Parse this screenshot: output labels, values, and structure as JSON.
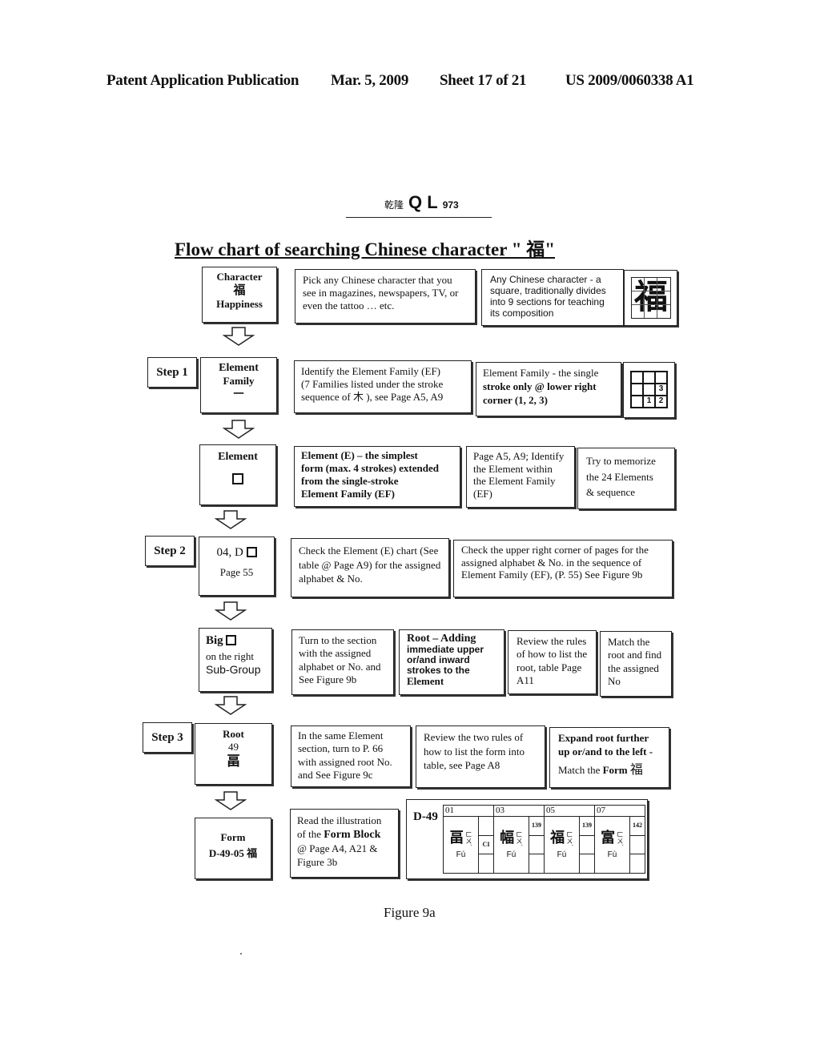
{
  "header": {
    "publication": "Patent Application Publication",
    "date": "Mar. 5, 2009",
    "sheet": "Sheet 17 of 21",
    "number": "US 2009/0060338 A1"
  },
  "logo": {
    "chinese": "乾隆",
    "letters": "Q L",
    "number": "973"
  },
  "title": "Flow chart of searching Chinese character \" 福\"",
  "rows": {
    "r0": {
      "node": {
        "line1": "Character",
        "char": "福",
        "line3": "Happiness"
      },
      "desc1": "Pick any Chinese character that you see in magazines, newspapers, TV, or even the tattoo … etc.",
      "desc2": "Any Chinese character - a square, traditionally divides into 9 sections for teaching its composition",
      "image_char": "福"
    },
    "r1": {
      "step": "Step 1",
      "node": {
        "line1": "Element",
        "line2": "Family",
        "char": "一"
      },
      "desc1_a": "Identify the Element Family (EF)",
      "desc1_b": "(7 Families listed under the stroke",
      "desc1_c": "sequence of 木 ), see Page A5, A9",
      "desc2_a": "Element Family - the single",
      "desc2_b": "stroke only @ lower right",
      "desc2_c": "corner (1, 2, 3)",
      "grid": [
        "",
        "",
        "",
        "",
        "",
        "3",
        "",
        "1",
        "2"
      ]
    },
    "r2": {
      "node": {
        "line1": "Element"
      },
      "desc1_a": "Element (E) – the simplest",
      "desc1_b": "form (max. 4 strokes) extended",
      "desc1_c": "from the single-stroke",
      "desc1_d": "Element Family (EF)",
      "desc2": "Page A5, A9; Identify the Element within the Element Family (EF)",
      "desc3_a": "Try to memorize",
      "desc3_b": "the 24 Elements",
      "desc3_c": "& sequence"
    },
    "r3": {
      "step": "Step 2",
      "node": {
        "line1": "04, D",
        "line2": "Page 55"
      },
      "desc1": "Check the Element (E) chart (See table @ Page A9) for the assigned alphabet & No.",
      "desc2": "Check the upper right corner of pages for the assigned alphabet & No. in the sequence of Element Family (EF), (P. 55) See Figure 9b"
    },
    "r4": {
      "node": {
        "line1": "Big",
        "line2": "on the right",
        "line3": "Sub-Group"
      },
      "desc1": "Turn to the section with the assigned alphabet or No. and See Figure 9b",
      "desc2_a": "Root – Adding",
      "desc2_b": "immediate upper or/and inward strokes to the",
      "desc2_c": "Element",
      "desc3": "Review the rules of how to list the root, table Page A11",
      "desc4": "Match the root and find the assigned No"
    },
    "r5": {
      "step": "Step 3",
      "node": {
        "line1": "Root",
        "line2": "49",
        "char": "畐"
      },
      "desc1": "In the same Element section, turn to P. 66 with assigned root No. and See Figure 9c",
      "desc2": "Review the two rules of how to list the form into table, see Page A8",
      "desc3_a": "Expand root further up or/and to the left -",
      "desc3_b": "Match the",
      "desc3_c": "Form",
      "desc3_d": "福"
    },
    "r6": {
      "node": {
        "line1": "Form",
        "line2": "D-49-05 福"
      },
      "desc1_a": "Read the illustration of the",
      "desc1_b": "Form Block",
      "desc1_c": "@ Page A4, A21 & Figure 3b"
    }
  },
  "form_table": {
    "label": "D-49",
    "entries": [
      {
        "num": "01",
        "char": "畐",
        "bopomofo": "ㄈㄨˊ",
        "pinyin": "Fú",
        "side_top": "",
        "side_mid": "CI"
      },
      {
        "num": "03",
        "char": "幅",
        "bopomofo": "ㄈㄨˊ",
        "pinyin": "Fú",
        "side_top": "139",
        "side_mid": ""
      },
      {
        "num": "05",
        "char": "福",
        "bopomofo": "ㄈㄨˊ",
        "pinyin": "Fú",
        "side_top": "139",
        "side_mid": ""
      },
      {
        "num": "07",
        "char": "富",
        "bopomofo": "ㄈㄨˋ",
        "pinyin": "Fù",
        "side_top": "142",
        "side_mid": ""
      }
    ]
  },
  "caption": "Figure 9a"
}
